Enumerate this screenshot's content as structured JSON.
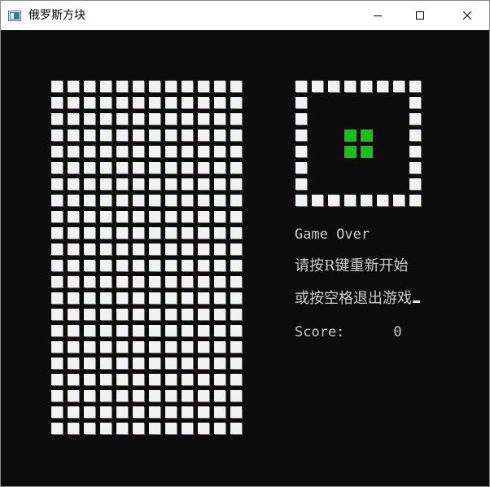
{
  "window": {
    "title": "俄罗斯方块",
    "controls": [
      "minimize",
      "maximize",
      "close"
    ]
  },
  "board": {
    "columns": 12,
    "rows": 22,
    "cell_color": "#f2f2f2",
    "background": "#0c0c0c"
  },
  "preview": {
    "frame_columns": 8,
    "frame_rows": 8,
    "piece_color": "#19c019",
    "piece": "O"
  },
  "status": {
    "game_over": "Game Over",
    "restart_hint": "请按R键重新开始",
    "exit_hint": "或按空格退出游戏",
    "score_label": "Score:",
    "score_value": "0"
  }
}
